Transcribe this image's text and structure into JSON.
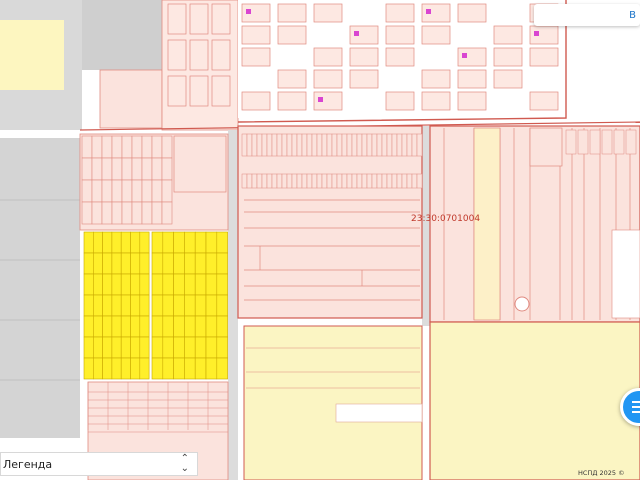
{
  "map": {
    "parcel_label": "23:30:0701004",
    "legend_label": "Легенда",
    "top_button_label": "В",
    "copyright": "НСПД 2025 ©",
    "colors": {
      "background": "#ffffff",
      "parcel_fill": "#fbe3dd",
      "parcel_stroke": "#e08a80",
      "boundary": "#d05a50",
      "road_gray": "#d9d9d9",
      "building_fill": "#fde8e2",
      "yellow_parcels": "#ffef2a",
      "pale_yellow": "#fbf5c3",
      "label_red": "#c0392b",
      "magenta_marker": "#d945d1",
      "fab_blue": "#2196f3"
    },
    "icons": {
      "legend_toggle": "chevron-up-down-icon",
      "fab": "list-icon"
    }
  }
}
